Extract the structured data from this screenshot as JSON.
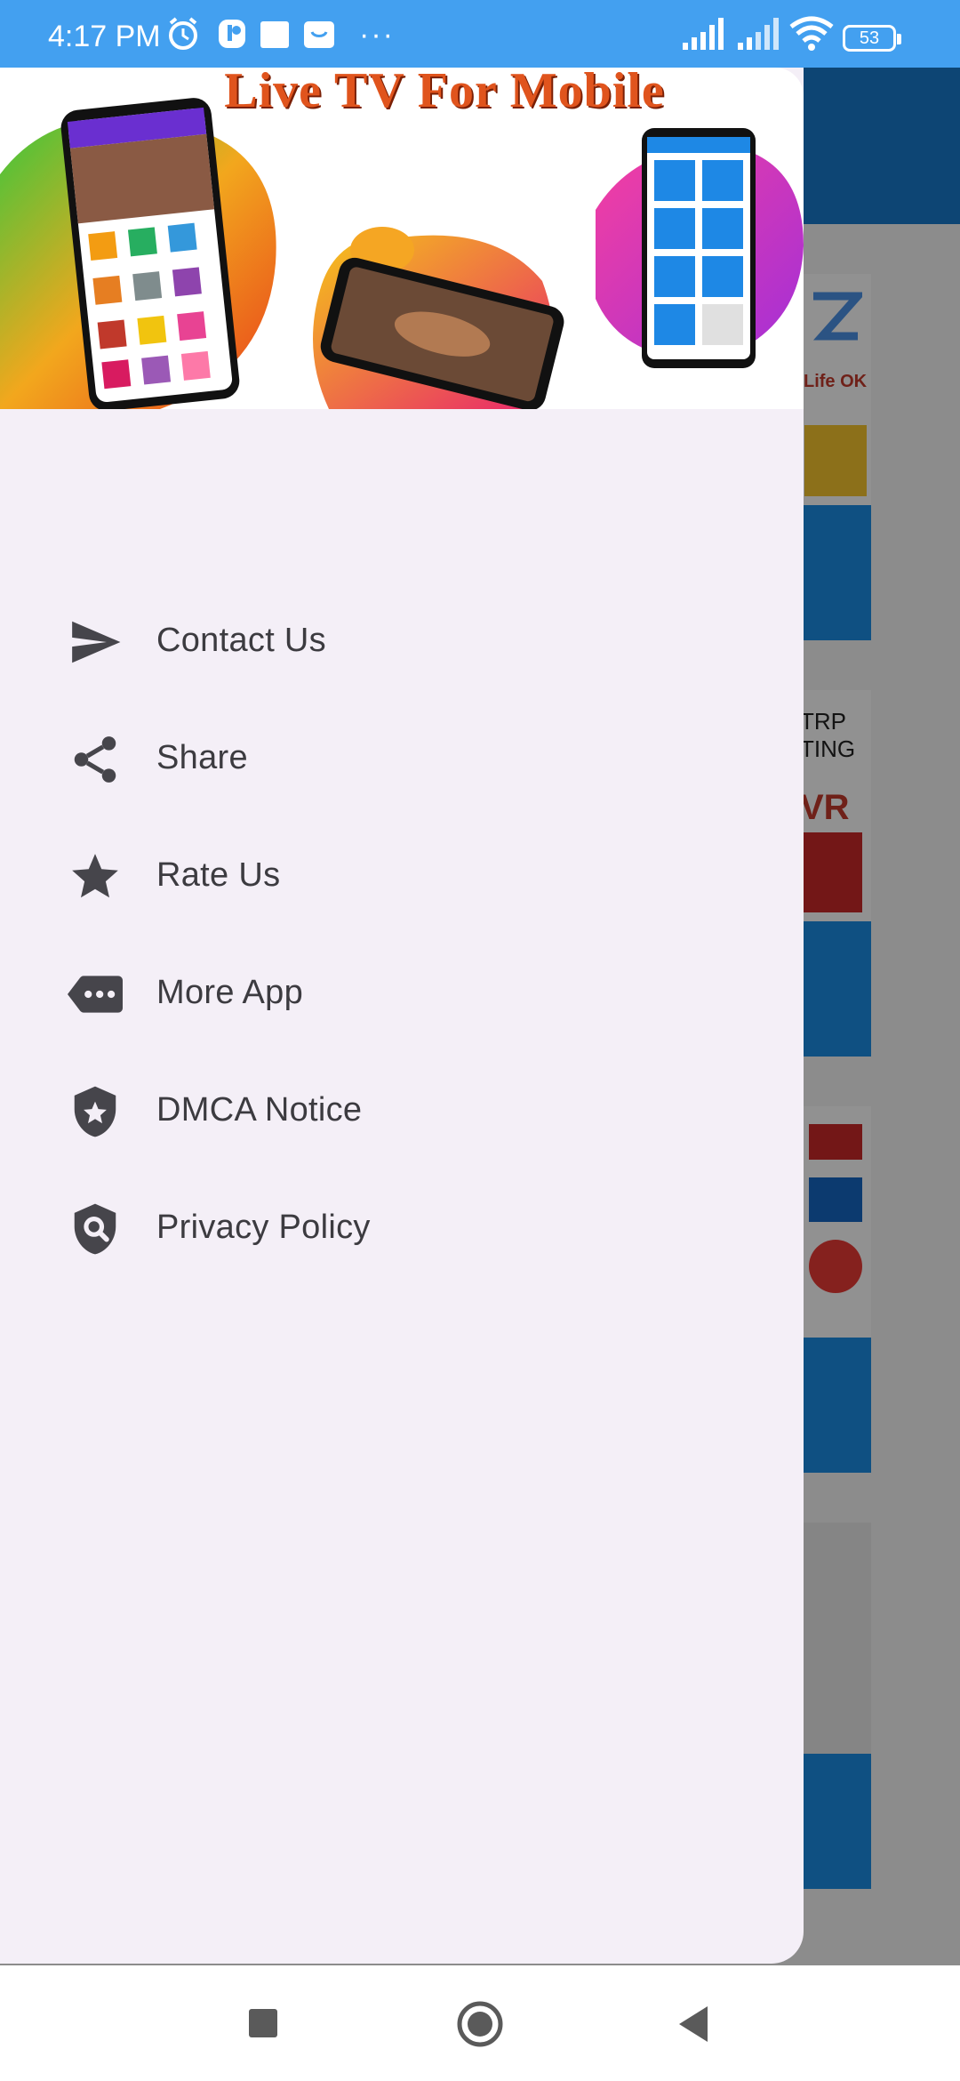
{
  "status_bar": {
    "time": "4:17 PM",
    "more_dots": "···",
    "battery": "53",
    "background_color": "#43a0f0"
  },
  "drawer": {
    "banner_title": "Live TV For Mobile",
    "menu_items": [
      {
        "label": "Contact Us",
        "icon": "send-icon"
      },
      {
        "label": "Share",
        "icon": "share-icon"
      },
      {
        "label": "Rate Us",
        "icon": "star-icon"
      },
      {
        "label": "More App",
        "icon": "more-apps-icon"
      },
      {
        "label": "DMCA Notice",
        "icon": "shield-star-icon"
      },
      {
        "label": "Privacy Policy",
        "icon": "shield-search-icon"
      }
    ],
    "background_color": "#f4eff7"
  },
  "colors": {
    "app_blue": "#1877c9",
    "icon_color": "#46454b"
  }
}
